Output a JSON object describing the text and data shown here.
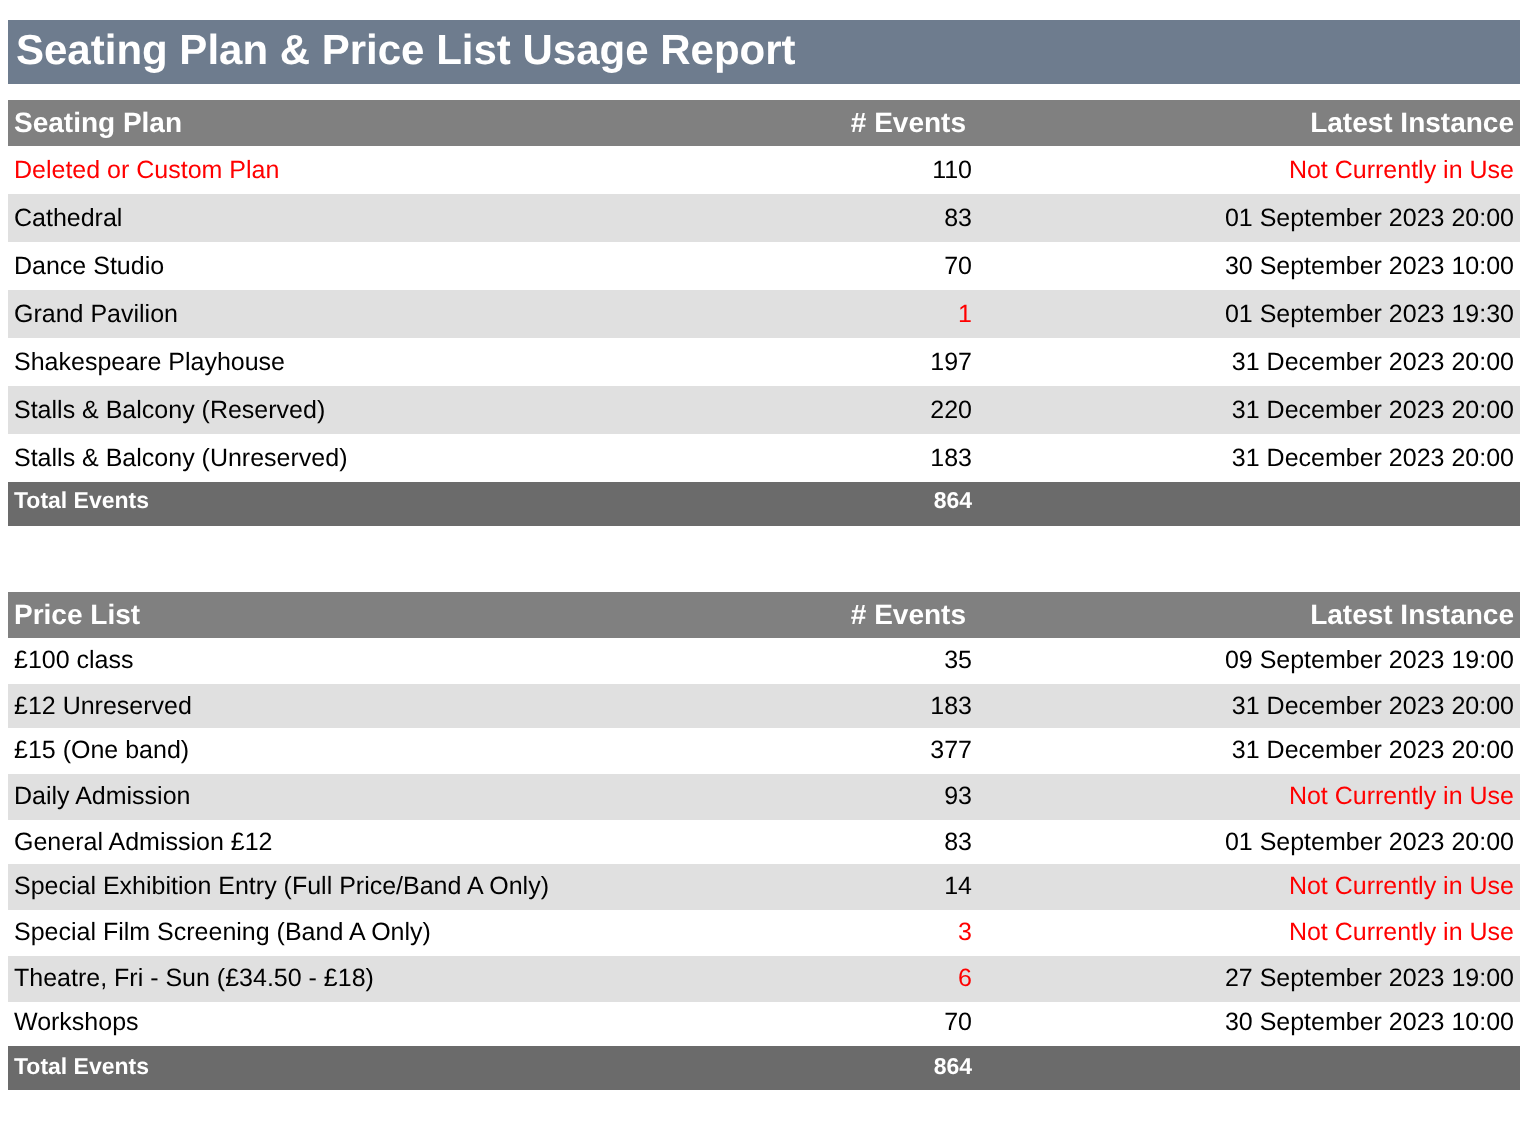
{
  "title": "Seating Plan & Price List Usage Report",
  "tables": [
    {
      "columns": [
        "Seating Plan",
        "# Events",
        "Latest Instance"
      ],
      "rows": [
        {
          "name": "Deleted or Custom Plan",
          "name_alert": true,
          "events": "110",
          "events_alert": false,
          "latest": "Not Currently in Use",
          "latest_alert": true
        },
        {
          "name": "Cathedral",
          "name_alert": false,
          "events": "83",
          "events_alert": false,
          "latest": "01 September 2023 20:00",
          "latest_alert": false
        },
        {
          "name": "Dance Studio",
          "name_alert": false,
          "events": "70",
          "events_alert": false,
          "latest": "30 September 2023 10:00",
          "latest_alert": false
        },
        {
          "name": "Grand Pavilion",
          "name_alert": false,
          "events": "1",
          "events_alert": true,
          "latest": "01 September 2023 19:30",
          "latest_alert": false
        },
        {
          "name": "Shakespeare Playhouse",
          "name_alert": false,
          "events": "197",
          "events_alert": false,
          "latest": "31 December 2023 20:00",
          "latest_alert": false
        },
        {
          "name": "Stalls & Balcony (Reserved)",
          "name_alert": false,
          "events": "220",
          "events_alert": false,
          "latest": "31 December 2023 20:00",
          "latest_alert": false
        },
        {
          "name": "Stalls & Balcony (Unreserved)",
          "name_alert": false,
          "events": "183",
          "events_alert": false,
          "latest": "31 December 2023 20:00",
          "latest_alert": false
        }
      ],
      "total": {
        "label": "Total Events",
        "events": "864"
      }
    },
    {
      "columns": [
        "Price List",
        "# Events",
        "Latest Instance"
      ],
      "rows": [
        {
          "name": "£100 class",
          "name_alert": false,
          "events": "35",
          "events_alert": false,
          "latest": "09 September 2023 19:00",
          "latest_alert": false
        },
        {
          "name": "£12 Unreserved",
          "name_alert": false,
          "events": "183",
          "events_alert": false,
          "latest": "31 December 2023 20:00",
          "latest_alert": false
        },
        {
          "name": "£15 (One band)",
          "name_alert": false,
          "events": "377",
          "events_alert": false,
          "latest": "31 December 2023 20:00",
          "latest_alert": false
        },
        {
          "name": "Daily Admission",
          "name_alert": false,
          "events": "93",
          "events_alert": false,
          "latest": "Not Currently in Use",
          "latest_alert": true
        },
        {
          "name": "General Admission £12",
          "name_alert": false,
          "events": "83",
          "events_alert": false,
          "latest": "01 September 2023 20:00",
          "latest_alert": false
        },
        {
          "name": "Special Exhibition Entry (Full Price/Band A Only)",
          "name_alert": false,
          "events": "14",
          "events_alert": false,
          "latest": "Not Currently in Use",
          "latest_alert": true
        },
        {
          "name": "Special Film Screening (Band A Only)",
          "name_alert": false,
          "events": "3",
          "events_alert": true,
          "latest": "Not Currently in Use",
          "latest_alert": true
        },
        {
          "name": "Theatre, Fri - Sun (£34.50 - £18)",
          "name_alert": false,
          "events": "6",
          "events_alert": true,
          "latest": "27 September 2023 19:00",
          "latest_alert": false
        },
        {
          "name": "Workshops",
          "name_alert": false,
          "events": "70",
          "events_alert": false,
          "latest": "30 September 2023 10:00",
          "latest_alert": false
        }
      ],
      "total": {
        "label": "Total Events",
        "events": "864"
      }
    }
  ]
}
